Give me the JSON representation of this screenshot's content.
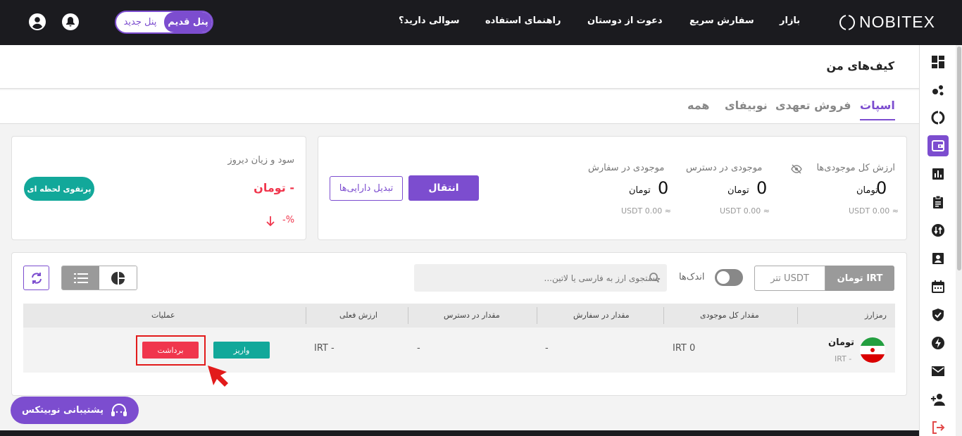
{
  "topbar": {
    "logo": "NOBITEX",
    "nav": [
      "بازار",
      "سفارش سریع",
      "دعوت از دوستان",
      "راهنمای استفاده",
      "سوالی دارید؟"
    ],
    "panel_old": "پنل قدیم",
    "panel_new": "پنل جدید"
  },
  "page": {
    "title": "کیف‌های من"
  },
  "tabs": [
    "اسپات",
    "فروش تعهدی",
    "نوبیفای",
    "همه"
  ],
  "summary": {
    "total_label": "ارزش کل موجودی‌ها",
    "total_value": "0",
    "total_unit": "تومان",
    "total_usdt": "USDT 0.00 ≈",
    "available_label": "موجودی در دسترس",
    "available_value": "0",
    "available_unit": "تومان",
    "available_usdt": "USDT 0.00 ≈",
    "order_label": "موجودی در سفارش",
    "order_value": "0",
    "order_unit": "تومان",
    "order_usdt": "USDT 0.00 ≈",
    "transfer_button": "انتقال",
    "convert_button": "تبدیل دارایی‌ها"
  },
  "pnl": {
    "title": "سود و زیان دیروز",
    "value": "- تومان",
    "percent": "-%",
    "portfolio_button": "پرتفوی لحظه ای"
  },
  "filters": {
    "irt_tab": "تومان IRT",
    "usdt_tab": "تتر USDT",
    "small_label": "اندک‌ها",
    "search_placeholder": "جستجوی ارز به فارسی یا لاتین..."
  },
  "table": {
    "headers": [
      "رمزارز",
      "مقدار کل موجودی",
      "مقدار در سفارش",
      "مقدار در دسترس",
      "ارزش فعلی",
      "عملیات"
    ],
    "rows": [
      {
        "name": "تومان",
        "symbol": "IRT -",
        "total": "IRT 0",
        "in_order": "-",
        "available": "-",
        "value": "IRT -",
        "deposit": "واریز",
        "withdraw": "برداشت"
      }
    ]
  },
  "support": {
    "label": "پشتیبانی نوبیتکس"
  },
  "colors": {
    "accent": "#7c4dcf",
    "teal": "#12a89a",
    "danger": "#f0364d",
    "topbar": "#1b1b1f"
  },
  "sidebar_icons": [
    "dashboard-icon",
    "market-icon",
    "loop-icon",
    "wallet-icon",
    "chart-icon",
    "clipboard-icon",
    "exchange-icon",
    "profile-icon",
    "calendar-icon",
    "shield-icon",
    "bolt-icon",
    "mail-icon",
    "add-user-icon",
    "logout-icon"
  ]
}
